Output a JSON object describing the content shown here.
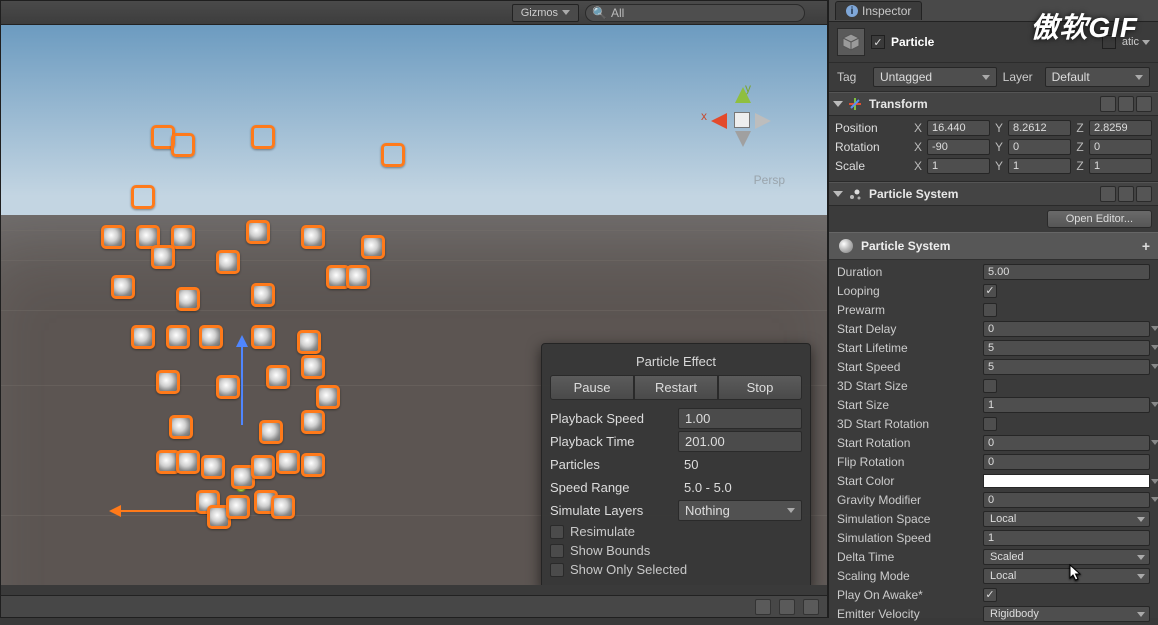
{
  "watermark": "傲软GIF",
  "scene": {
    "gizmos_label": "Gizmos",
    "search_placeholder": "All",
    "persp_label": "Persp",
    "axis": {
      "x": "x",
      "y": "y"
    }
  },
  "fx": {
    "title": "Particle Effect",
    "buttons": {
      "pause": "Pause",
      "restart": "Restart",
      "stop": "Stop"
    },
    "playback_speed_label": "Playback Speed",
    "playback_speed": "1.00",
    "playback_time_label": "Playback Time",
    "playback_time": "201.00",
    "particles_label": "Particles",
    "particles": "50",
    "speed_range_label": "Speed Range",
    "speed_range": "5.0 - 5.0",
    "simulate_layers_label": "Simulate Layers",
    "simulate_layers_value": "Nothing",
    "resimulate": "Resimulate",
    "show_bounds": "Show Bounds",
    "show_only_selected": "Show Only Selected"
  },
  "inspector": {
    "tab": "Inspector",
    "go_name": "Particle",
    "static_label": "atic",
    "tag_label": "Tag",
    "tag_value": "Untagged",
    "layer_label": "Layer",
    "layer_value": "Default",
    "transform": {
      "title": "Transform",
      "position_label": "Position",
      "rotation_label": "Rotation",
      "scale_label": "Scale",
      "pos": {
        "x": "16.440",
        "y": "8.2612",
        "z": "2.8259"
      },
      "rot": {
        "x": "-90",
        "y": "0",
        "z": "0"
      },
      "scale": {
        "x": "1",
        "y": "1",
        "z": "1"
      }
    },
    "ps": {
      "title": "Particle System",
      "open_editor": "Open Editor...",
      "module_title": "Particle System",
      "duration_label": "Duration",
      "duration": "5.00",
      "looping_label": "Looping",
      "looping": true,
      "prewarm_label": "Prewarm",
      "prewarm": false,
      "start_delay_label": "Start Delay",
      "start_delay": "0",
      "start_lifetime_label": "Start Lifetime",
      "start_lifetime": "5",
      "start_speed_label": "Start Speed",
      "start_speed": "5",
      "threeD_start_size_label": "3D Start Size",
      "threeD_start_size": false,
      "start_size_label": "Start Size",
      "start_size": "1",
      "threeD_start_rot_label": "3D Start Rotation",
      "threeD_start_rot": false,
      "start_rotation_label": "Start Rotation",
      "start_rotation": "0",
      "flip_rotation_label": "Flip Rotation",
      "flip_rotation": "0",
      "start_color_label": "Start Color",
      "start_color": "#ffffff",
      "gravity_mod_label": "Gravity Modifier",
      "gravity_mod": "0",
      "sim_space_label": "Simulation Space",
      "sim_space": "Local",
      "sim_speed_label": "Simulation Speed",
      "sim_speed": "1",
      "delta_time_label": "Delta Time",
      "delta_time": "Scaled",
      "scaling_mode_label": "Scaling Mode",
      "scaling_mode": "Local",
      "play_on_awake_label": "Play On Awake*",
      "play_on_awake": true,
      "emitter_velocity_label": "Emitter Velocity",
      "emitter_velocity": "Rigidbody"
    }
  }
}
